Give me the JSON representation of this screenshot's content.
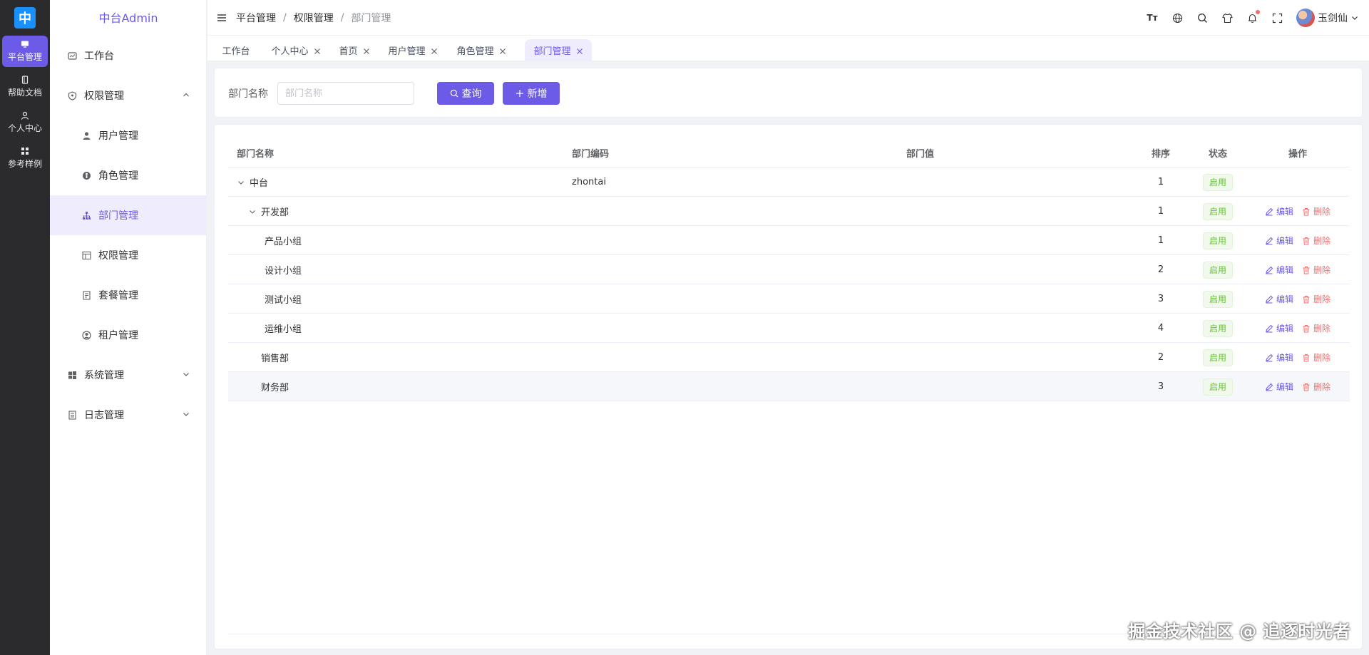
{
  "rail": {
    "logo": "中",
    "items": [
      {
        "label": "平台管理",
        "icon": "monitor-icon",
        "active": true
      },
      {
        "label": "帮助文档",
        "icon": "book-icon"
      },
      {
        "label": "个人中心",
        "icon": "user-icon"
      },
      {
        "label": "参考样例",
        "icon": "grid-icon"
      }
    ]
  },
  "sidebar": {
    "title": "中台Admin",
    "items": [
      {
        "label": "工作台",
        "icon": "dashboard-icon"
      },
      {
        "label": "权限管理",
        "icon": "shield-icon",
        "expanded": true
      },
      {
        "label": "用户管理",
        "icon": "person-icon"
      },
      {
        "label": "角色管理",
        "icon": "role-icon"
      },
      {
        "label": "部门管理",
        "icon": "org-icon",
        "active": true
      },
      {
        "label": "权限管理",
        "icon": "permission-icon"
      },
      {
        "label": "套餐管理",
        "icon": "package-icon"
      },
      {
        "label": "租户管理",
        "icon": "tenant-icon"
      },
      {
        "label": "系统管理",
        "icon": "windows-icon",
        "expanded": false
      },
      {
        "label": "日志管理",
        "icon": "log-icon",
        "expanded": false
      }
    ]
  },
  "header": {
    "breadcrumb": [
      "平台管理",
      "权限管理",
      "部门管理"
    ],
    "font_icon_label": "Tт",
    "user_name": "玉剑仙"
  },
  "tabs": [
    {
      "label": "工作台",
      "closable": false
    },
    {
      "label": "个人中心",
      "closable": true
    },
    {
      "label": "首页",
      "closable": true
    },
    {
      "label": "用户管理",
      "closable": true
    },
    {
      "label": "角色管理",
      "closable": true
    },
    {
      "label": "部门管理",
      "closable": true,
      "active": true
    }
  ],
  "search": {
    "label": "部门名称",
    "placeholder": "部门名称",
    "value": "",
    "query_label": "查询",
    "add_label": "新增"
  },
  "table": {
    "columns": [
      "部门名称",
      "部门编码",
      "部门值",
      "排序",
      "状态",
      "操作"
    ],
    "rows": [
      {
        "name": "中台",
        "code": "zhontai",
        "value": "",
        "sort": "1",
        "status": "启用",
        "level": 0,
        "expandable": true,
        "actions": false
      },
      {
        "name": "开发部",
        "code": "",
        "value": "",
        "sort": "1",
        "status": "启用",
        "level": 1,
        "expandable": true,
        "actions": true
      },
      {
        "name": "产品小组",
        "code": "",
        "value": "",
        "sort": "1",
        "status": "启用",
        "level": 2,
        "expandable": false,
        "actions": true
      },
      {
        "name": "设计小组",
        "code": "",
        "value": "",
        "sort": "2",
        "status": "启用",
        "level": 2,
        "expandable": false,
        "actions": true
      },
      {
        "name": "测试小组",
        "code": "",
        "value": "",
        "sort": "3",
        "status": "启用",
        "level": 2,
        "expandable": false,
        "actions": true
      },
      {
        "name": "运维小组",
        "code": "",
        "value": "",
        "sort": "4",
        "status": "启用",
        "level": 2,
        "expandable": false,
        "actions": true
      },
      {
        "name": "销售部",
        "code": "",
        "value": "",
        "sort": "2",
        "status": "启用",
        "level": 1,
        "expandable": false,
        "actions": true
      },
      {
        "name": "财务部",
        "code": "",
        "value": "",
        "sort": "3",
        "status": "启用",
        "level": 1,
        "expandable": false,
        "actions": true,
        "hover": true
      }
    ],
    "edit_label": "编辑",
    "delete_label": "删除"
  },
  "watermark": "掘金技术社区 @ 追逐时光者",
  "colors": {
    "accent": "#6b5be6",
    "success": "#67c23a",
    "danger": "#f56c6c",
    "rail_bg": "#2b2b2e"
  }
}
